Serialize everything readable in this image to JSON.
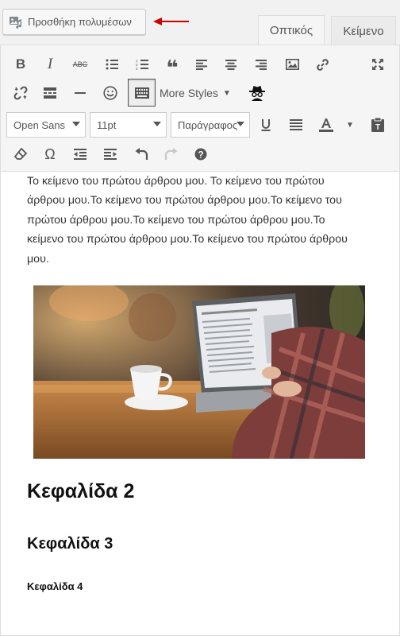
{
  "header": {
    "add_media_label": "Προσθήκη πολυμέσων",
    "tabs": [
      {
        "label": "Οπτικός",
        "active": true
      },
      {
        "label": "Κείμενο",
        "active": false
      }
    ],
    "arrow_color": "#cc0000"
  },
  "toolbar": {
    "row1": [
      {
        "name": "bold",
        "glyph": "B"
      },
      {
        "name": "italic",
        "glyph": "I"
      },
      {
        "name": "strikethrough",
        "glyph": "ABC"
      },
      {
        "name": "bullet-list",
        "icon": "bullet-list-icon"
      },
      {
        "name": "numbered-list",
        "icon": "numbered-list-icon"
      },
      {
        "name": "blockquote",
        "glyph": "❝"
      },
      {
        "name": "align-left",
        "icon": "align-left-icon"
      },
      {
        "name": "align-center",
        "icon": "align-center-icon"
      },
      {
        "name": "align-right",
        "icon": "align-right-icon"
      },
      {
        "name": "insert-image",
        "icon": "image-icon"
      },
      {
        "name": "insert-link",
        "icon": "link-icon"
      },
      {
        "name": "fullscreen",
        "icon": "fullscreen-icon"
      }
    ],
    "row2": {
      "more_styles_label": "More Styles",
      "icons": [
        "unlink-icon",
        "read-more-icon",
        "horizontal-line-icon",
        "emoji-icon",
        "toolbar-toggle-icon",
        "spy-icon"
      ],
      "toolbar_toggle_pressed": true
    },
    "row3": {
      "font_family": "Open Sans",
      "font_size": "11pt",
      "block_format": "Παράγραφος",
      "icons": [
        "underline-icon",
        "justify-icon",
        "text-color-icon",
        "paste-text-icon"
      ]
    },
    "row4": {
      "icons": [
        "clear-formatting-icon",
        "special-character-icon",
        "outdent-icon",
        "indent-icon",
        "undo-icon",
        "redo-icon",
        "help-icon"
      ]
    }
  },
  "content": {
    "paragraph_lines": [
      "Το κείμενο του πρώτου άρθρου μου. Το κείμενο του πρώτου",
      "άρθρου μου.Το κείμενο του πρώτου άρθρου μου.Το κείμενο του",
      "πρώτου άρθρου μου.Το κείμενο του πρώτου άρθρου μου.Το",
      "κείμενο του πρώτου άρθρου μου.Το κείμενο του πρώτου άρθρου",
      "μου."
    ],
    "heading2": "Κεφαλίδα 2",
    "heading3": "Κεφαλίδα 3",
    "heading4": "Κεφαλίδα 4"
  }
}
